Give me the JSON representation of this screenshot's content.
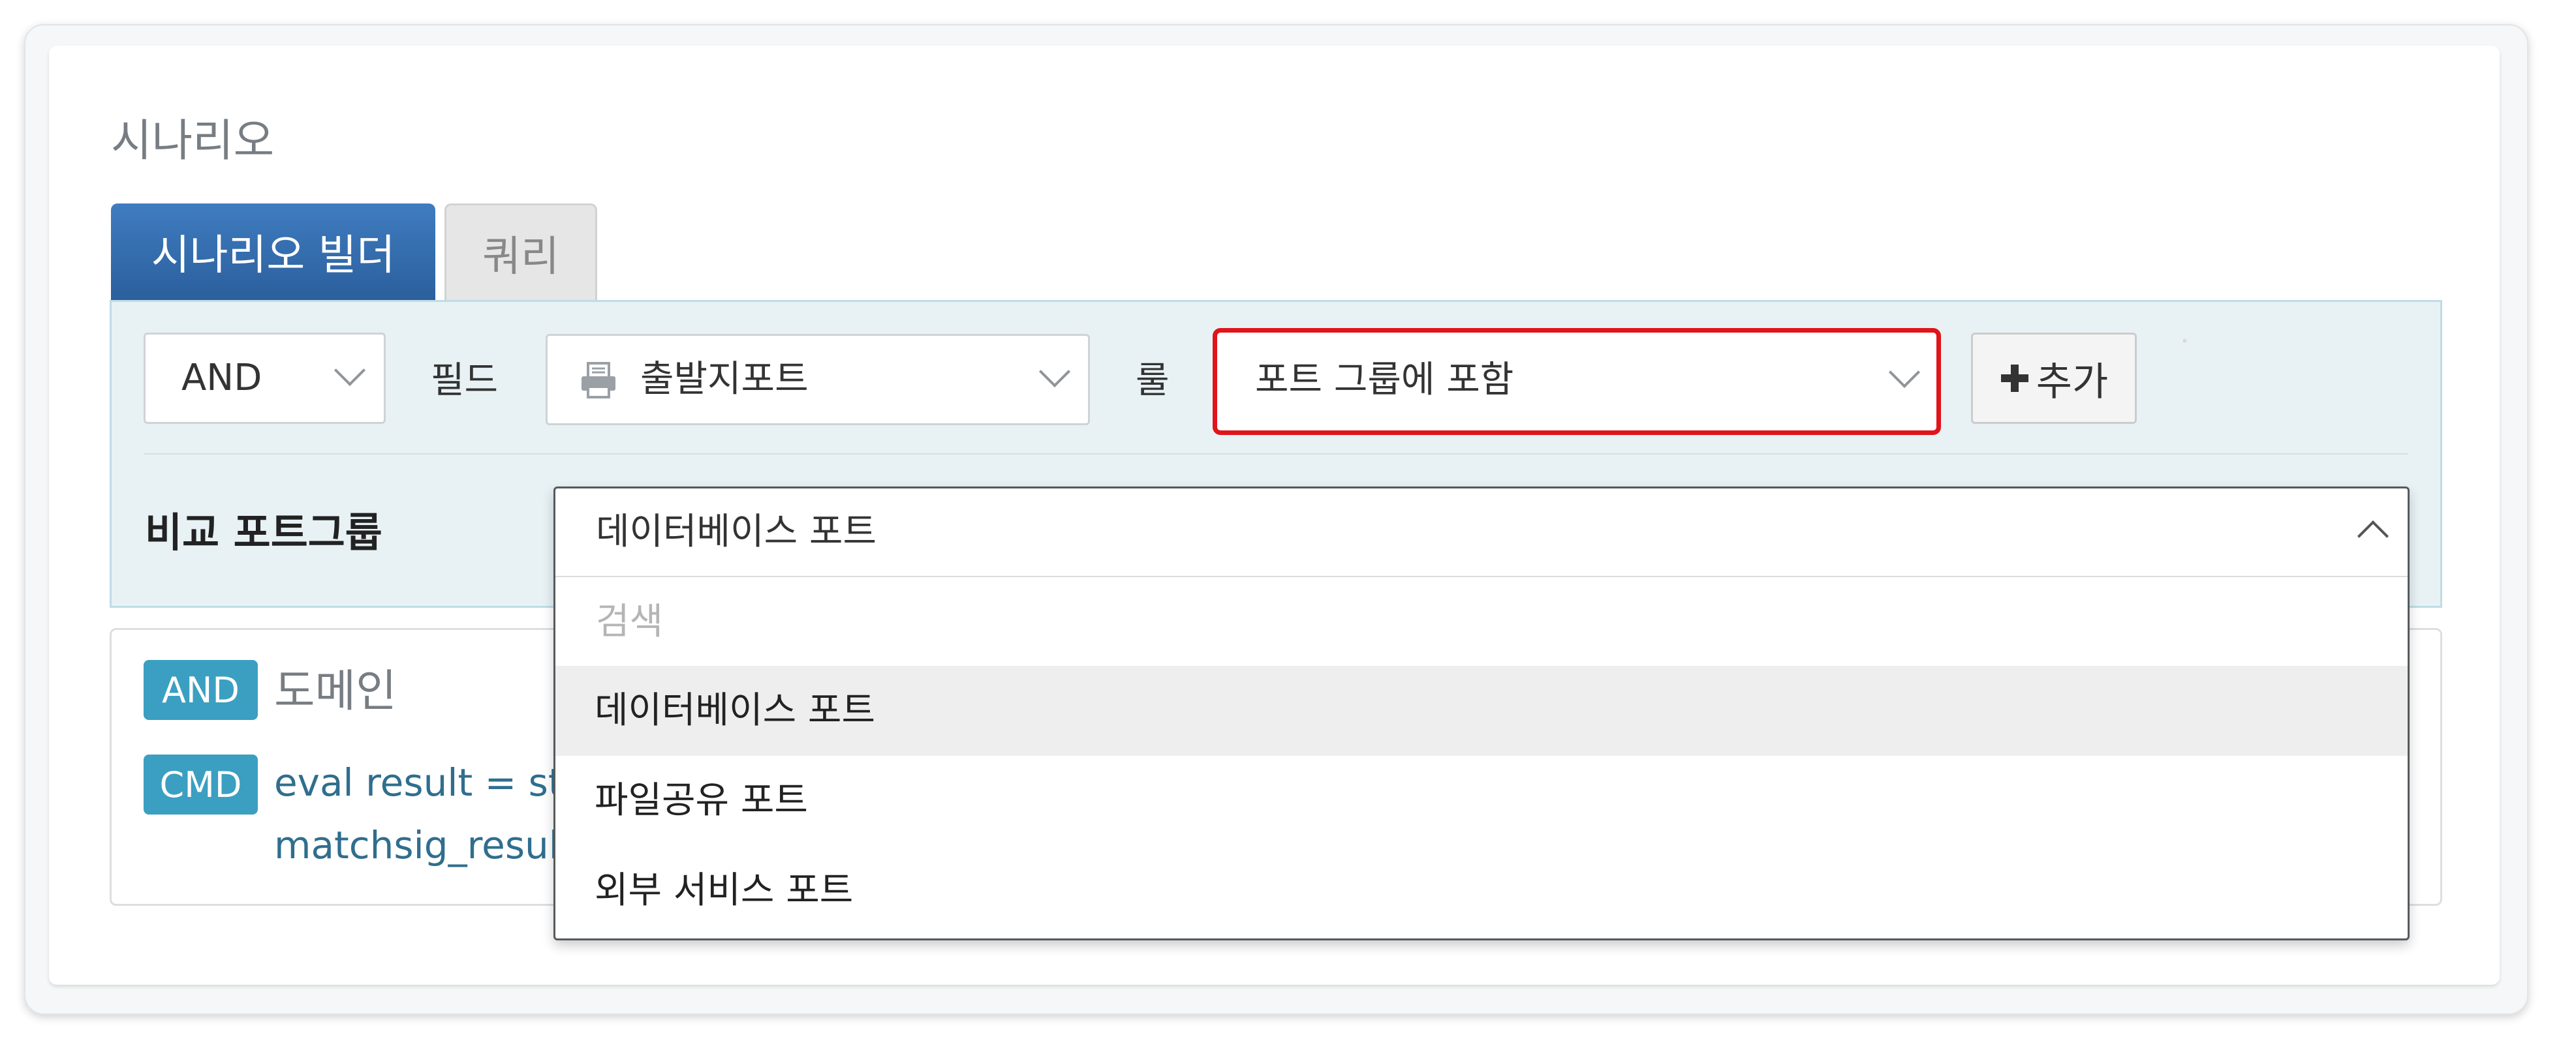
{
  "section": {
    "title": "시나리오"
  },
  "tabs": [
    {
      "label": "시나리오 빌더",
      "active": true
    },
    {
      "label": "쿼리",
      "active": false
    }
  ],
  "builder": {
    "operator": {
      "value": "AND"
    },
    "field": {
      "label": "필드",
      "value": "출발지포트",
      "icon": "field-printer-icon"
    },
    "rule": {
      "label": "룰",
      "value": "포트 그룹에 포함"
    },
    "add_button": {
      "label": "추가",
      "icon": "plus-icon"
    },
    "compare": {
      "label": "비교 포트그룹",
      "selected": "데이터베이스 포트",
      "search_placeholder": "검색",
      "options": [
        "데이터베이스 포트",
        "파일공유 포트",
        "외부 서비스 포트"
      ],
      "highlighted_index": 0
    }
  },
  "result": {
    "domain_badge": "AND",
    "domain_text": "도메인",
    "cmd_badge": "CMD",
    "cmd_line1": "eval result = strjo",
    "cmd_line2": "matchsig_result"
  },
  "colors": {
    "tab_active": "#2b5f9d",
    "badge": "#3b9fc2",
    "highlight_border": "#e0141b",
    "builder_bg": "#e8f2f5"
  }
}
